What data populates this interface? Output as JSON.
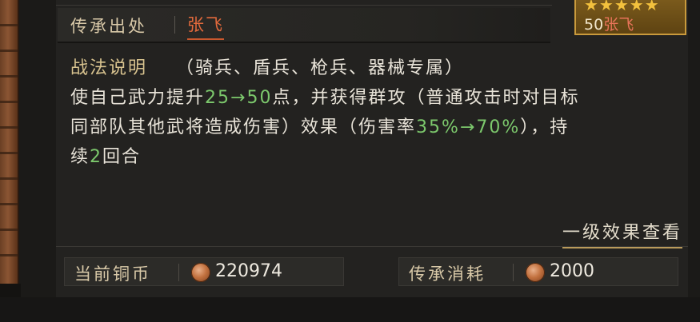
{
  "origin": {
    "label": "传承出处",
    "hero_link": "张飞"
  },
  "hero_card": {
    "stars": "★★★★★",
    "cost": "50",
    "name": "张飞"
  },
  "description": {
    "title": "战法说明",
    "troop_types": "（骑兵、盾兵、枪兵、器械专属）",
    "line2_a": "使自己武力提升",
    "line2_val": "25→50",
    "line2_b": "点，并获得群攻（普通攻击时对目标",
    "line3_a": "同部队其他武将造成伤害）效果（伤害率",
    "line3_val": "35%→70%",
    "line3_b": "），持",
    "line4_a": "续",
    "line4_val": "2",
    "line4_b": "回合"
  },
  "detail_link": "一级效果查看",
  "stats": {
    "coins_label": "当前铜币",
    "coins_value": "220974",
    "cost_label": "传承消耗",
    "cost_value": "2000"
  },
  "colors": {
    "accent_orange": "#e36a3c",
    "value_green": "#7cc86c",
    "gold": "#c99a3c"
  }
}
